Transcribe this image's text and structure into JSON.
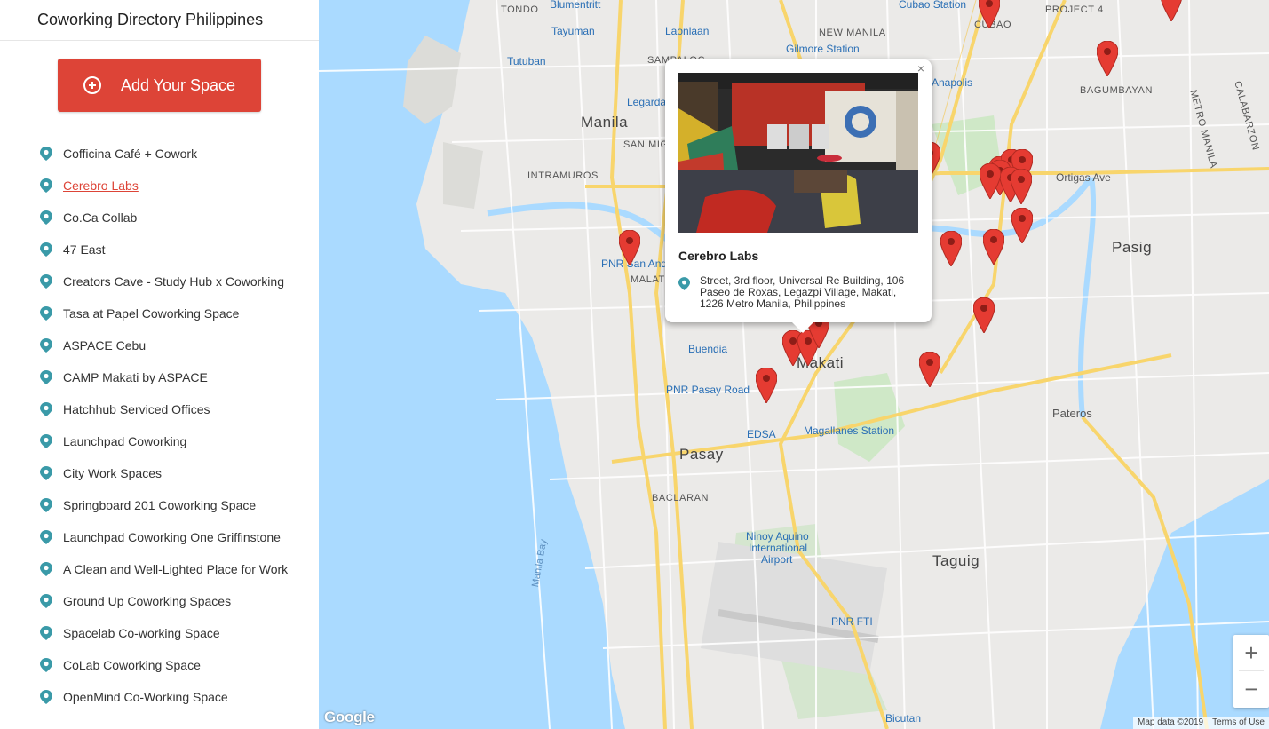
{
  "sidebar": {
    "title": "Coworking Directory Philippines",
    "add_button": "Add Your Space",
    "items": [
      {
        "label": "Cofficina Café + Cowork"
      },
      {
        "label": "Cerebro Labs"
      },
      {
        "label": "Co.Ca Collab"
      },
      {
        "label": "47 East"
      },
      {
        "label": "Creators Cave - Study Hub x Coworking"
      },
      {
        "label": "Tasa at Papel Coworking Space"
      },
      {
        "label": "ASPACE Cebu"
      },
      {
        "label": "CAMP Makati by ASPACE"
      },
      {
        "label": "Hatchhub Serviced Offices"
      },
      {
        "label": "Launchpad Coworking"
      },
      {
        "label": "City Work Spaces"
      },
      {
        "label": "Springboard 201 Coworking Space"
      },
      {
        "label": "Launchpad Coworking One Griffinstone"
      },
      {
        "label": "A Clean and Well-Lighted Place for Work"
      },
      {
        "label": "Ground Up Coworking Spaces"
      },
      {
        "label": "Spacelab Co-working Space"
      },
      {
        "label": "CoLab Coworking Space"
      },
      {
        "label": "OpenMind Co-Working Space"
      }
    ],
    "active_index": 1
  },
  "popup": {
    "name": "Cerebro Labs",
    "address": "Street, 3rd floor, Universal Re Building, 106 Paseo de Roxas, Legazpi Village, Makati, 1226 Metro Manila, Philippines",
    "close": "×"
  },
  "map": {
    "labels": {
      "tondo": "TONDO",
      "blumentritt": "Blumentritt",
      "tayuman": "Tayuman",
      "laonlaan": "Laonlaan",
      "tutuban": "Tutuban",
      "sampaloc": "SAMPALOC",
      "new_manila": "NEW MANILA",
      "gilmore": "Gilmore Station",
      "cubao_station": "Cubao Station",
      "cubao": "CUBAO",
      "project4": "PROJECT 4",
      "bagumbayan": "BAGUMBAYAN",
      "metro_manila": "METRO MANILA",
      "calabarzon": "CALABARZON",
      "legarda": "Legarda",
      "anapolis": "Anapolis",
      "manila": "Manila",
      "san_miguel": "SAN MIG",
      "intramuros": "INTRAMUROS",
      "ortigas": "Ortigas Ave",
      "pasig": "Pasig",
      "pnr_san_andres": "PNR San And",
      "malate": "MALAT",
      "buendia": "Buendia",
      "makati": "Makati",
      "pnr_pasay": "PNR Pasay Road",
      "edsa": "EDSA",
      "magallanes": "Magallanes Station",
      "pasay": "Pasay",
      "baclaran": "BACLARAN",
      "pateros": "Pateros",
      "ninoy": "Ninoy Aquino",
      "international": "International",
      "airport": "Airport",
      "taguig": "Taguig",
      "manila_bay": "Manila Bay",
      "pnr_fti": "PNR FTI",
      "bicutan": "Bicutan"
    },
    "zoom_in": "+",
    "zoom_out": "−",
    "logo": "Google",
    "map_data": "Map data ©2019",
    "terms": "Terms of Use"
  },
  "colors": {
    "accent": "#dd4437",
    "pin_teal": "#3a9aa8",
    "water": "#aadaff",
    "road": "#f8d56c"
  }
}
